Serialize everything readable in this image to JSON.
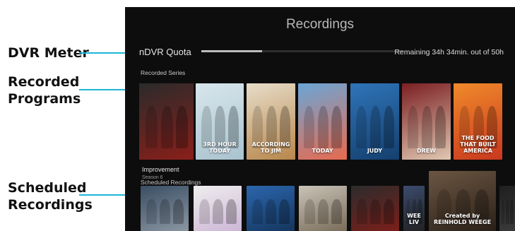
{
  "callouts": {
    "dvr_meter": "DVR Meter",
    "recorded_programs_line1": "Recorded",
    "recorded_programs_line2": "Programs",
    "scheduled_recordings_line1": "Scheduled",
    "scheduled_recordings_line2": "Recordings"
  },
  "screen": {
    "title": "Recordings",
    "quota_label": "nDVR Quota",
    "quota_used_fraction": 0.3,
    "remaining_text": "Remaining 34h 34min. out of 50h",
    "recorded_series_label": "Recorded Series",
    "scheduled_recordings_label": "Scheduled Recordings",
    "focused_title": "Improvement",
    "focused_season": "Season 6"
  },
  "recorded_tiles": [
    {
      "name": "home-improvement",
      "colors": [
        "#2b2b2b",
        "#8a1f1a"
      ],
      "text": ""
    },
    {
      "name": "3rd-hour-today",
      "colors": [
        "#d8e6ec",
        "#a9c3cf"
      ],
      "text": "3RD HOUR TODAY"
    },
    {
      "name": "according-to-jim",
      "colors": [
        "#e7ddc9",
        "#b8874c"
      ],
      "text": "ACCORDING TO JIM"
    },
    {
      "name": "today",
      "colors": [
        "#6aa6d6",
        "#e86a4f"
      ],
      "text": "TODAY"
    },
    {
      "name": "judy",
      "colors": [
        "#2f74b8",
        "#14406f"
      ],
      "text": "JUDY"
    },
    {
      "name": "drew",
      "colors": [
        "#7b1f22",
        "#e0c7b2"
      ],
      "text": "DREW"
    },
    {
      "name": "the-food-that-built-america",
      "colors": [
        "#f08a2a",
        "#c9381f"
      ],
      "text": "THE FOOD THAT BUILT AMERICA"
    }
  ],
  "scheduled_tiles": [
    {
      "name": "talk-show",
      "colors": [
        "#3a4e63",
        "#8b96a3"
      ],
      "text": ""
    },
    {
      "name": "dance-show",
      "colors": [
        "#eeeeee",
        "#cdb6d6"
      ],
      "text": ""
    },
    {
      "name": "judge-show",
      "colors": [
        "#2b66ad",
        "#15365e"
      ],
      "text": ""
    },
    {
      "name": "sitcom-family",
      "colors": [
        "#c9c3b7",
        "#7a6c5a"
      ],
      "text": ""
    },
    {
      "name": "home-improvement-2",
      "colors": [
        "#2c2c2c",
        "#7b1f1a"
      ],
      "text": ""
    },
    {
      "name": "weekend-live",
      "colors": [
        "#3b4b6d",
        "#222"
      ],
      "text": "WEE LIV"
    },
    {
      "name": "reinhold-weege",
      "colors": [
        "#6b5642",
        "#2a2018"
      ],
      "text": "Created by REINHOLD WEEGE"
    },
    {
      "name": "edge-tile",
      "colors": [
        "#1f1f1f",
        "#3a3a3a"
      ],
      "text": ""
    }
  ]
}
